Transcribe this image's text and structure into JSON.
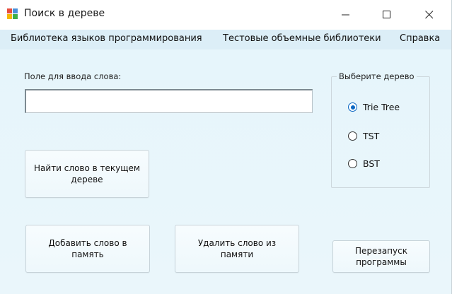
{
  "window": {
    "title": "Поиск в дереве"
  },
  "menu": {
    "items": [
      "Библиотека языков программирования",
      "Тестовые объемные библиотеки",
      "Справка"
    ]
  },
  "form": {
    "input_label": "Поле для ввода слова:",
    "input_value": "",
    "group_title": "Выберите дерево",
    "radios": [
      {
        "label": "Trie Tree",
        "checked": true
      },
      {
        "label": "TST",
        "checked": false
      },
      {
        "label": "BST",
        "checked": false
      }
    ],
    "buttons": {
      "find": "Найти слово в текущем дереве",
      "add": "Добавить слово в память",
      "delete": "Удалить слово из памяти",
      "restart": "Перезапуск программы"
    }
  },
  "colors": {
    "accent": "#0a66c2",
    "background": "#e9f5fb"
  }
}
